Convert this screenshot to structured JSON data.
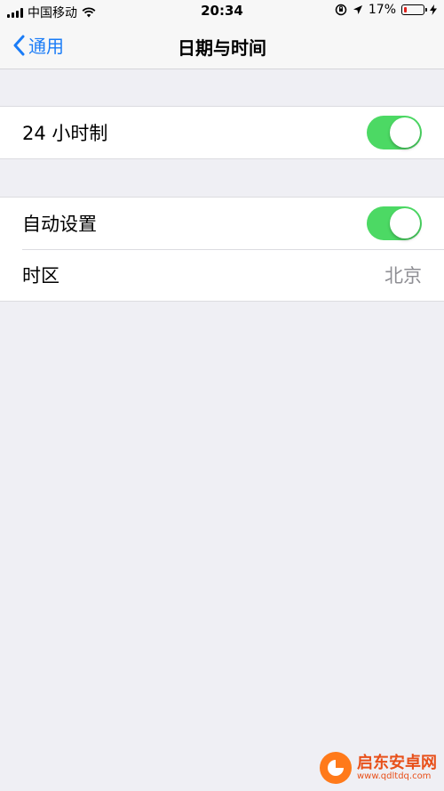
{
  "status_bar": {
    "carrier": "中国移动",
    "time": "20:34",
    "battery_percent": "17%",
    "battery_level": 0.17,
    "battery_color": "#e0201b"
  },
  "nav": {
    "back_label": "通用",
    "title": "日期与时间"
  },
  "settings": {
    "hour24": {
      "label": "24 小时制",
      "on": true
    },
    "auto_set": {
      "label": "自动设置",
      "on": true
    },
    "timezone": {
      "label": "时区",
      "value": "北京"
    }
  },
  "watermark": {
    "name": "启东安卓网",
    "url": "www.qdltdq.com"
  },
  "colors": {
    "accent": "#1a7cf7",
    "toggle_on": "#4cd964",
    "background": "#efeff4"
  }
}
